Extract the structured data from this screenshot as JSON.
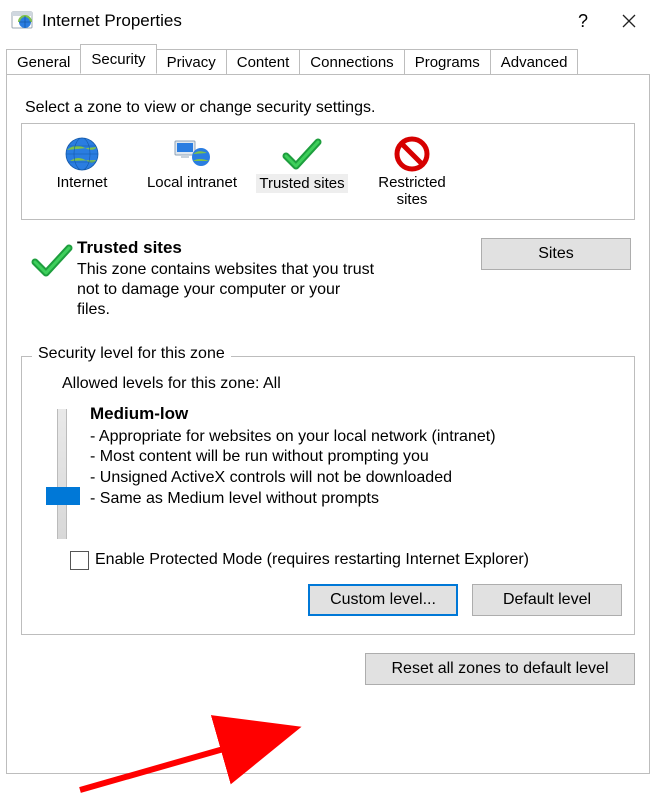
{
  "window": {
    "title": "Internet Properties"
  },
  "tabs": [
    "General",
    "Security",
    "Privacy",
    "Content",
    "Connections",
    "Programs",
    "Advanced"
  ],
  "active_tab": 1,
  "instruction": "Select a zone to view or change security settings.",
  "zones": [
    {
      "label": "Internet"
    },
    {
      "label": "Local intranet"
    },
    {
      "label": "Trusted sites"
    },
    {
      "label": "Restricted sites"
    }
  ],
  "selected_zone": 2,
  "zone_detail": {
    "heading": "Trusted sites",
    "description": "This zone contains websites that you trust not to damage your computer or your files.",
    "sites_button": "Sites"
  },
  "security": {
    "group_label": "Security level for this zone",
    "allowed": "Allowed levels for this zone: All",
    "level_name": "Medium-low",
    "bullets": [
      "- Appropriate for websites on your local network (intranet)",
      "- Most content will be run without prompting you",
      "- Unsigned ActiveX controls will not be downloaded",
      "- Same as Medium level without prompts"
    ],
    "protected_mode": "Enable Protected Mode (requires restarting Internet Explorer)",
    "custom_button": "Custom level...",
    "default_button": "Default level"
  },
  "reset_button": "Reset all zones to default level"
}
